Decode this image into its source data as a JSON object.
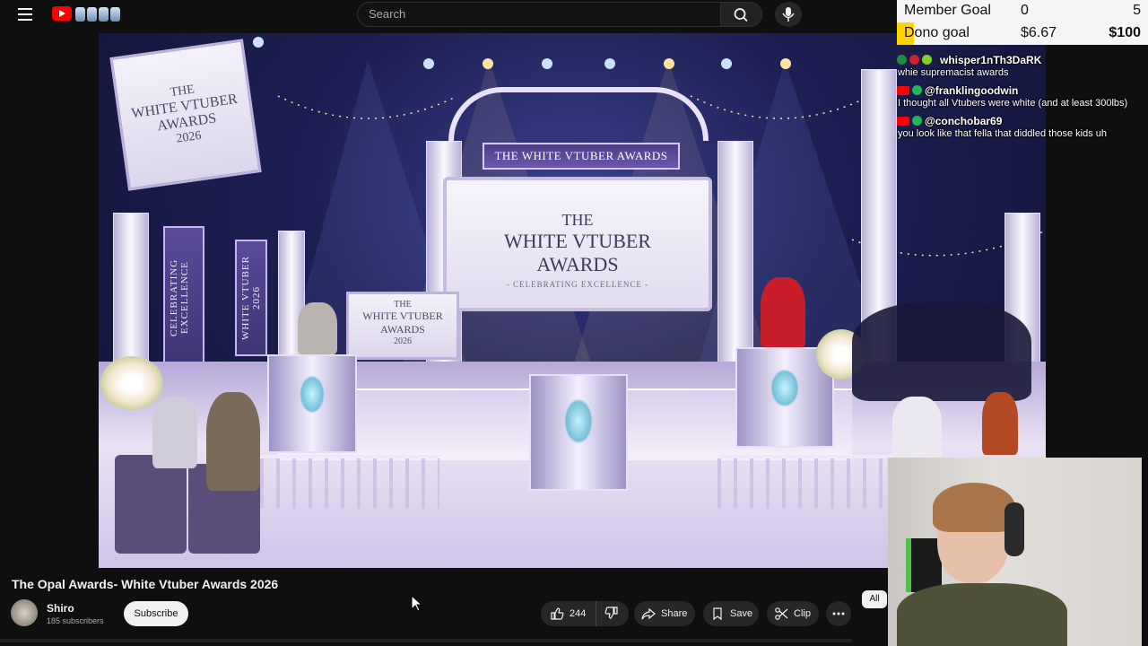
{
  "topbar": {
    "search_placeholder": "Search"
  },
  "overlay": {
    "member_goal": {
      "label": "Member Goal",
      "current": "0",
      "target": "5"
    },
    "dono_goal": {
      "label": "Dono goal",
      "current": "$6.67",
      "target": "$100",
      "progress": 0.067
    },
    "colors": {
      "goal_bg": "#f5f5f5",
      "goal_fill": "#ffd400"
    }
  },
  "chat": [
    {
      "user": "whisper1nTh3DaRK",
      "text": "whie supremacist awards"
    },
    {
      "user": "@franklingoodwin",
      "text": "I thought all Vtubers were white (and at least 300lbs)"
    },
    {
      "user": "@conchobar69",
      "text": "you look like that fella that diddled those kids uh"
    }
  ],
  "video_art": {
    "arch_ribbon": "THE WHITE VTUBER AWARDS",
    "main_sign": {
      "line1": "THE",
      "line2": "WHITE VTUBER",
      "line3": "AWARDS",
      "tagline": "- CELEBRATING EXCELLENCE -"
    },
    "left_sign": {
      "line1": "THE",
      "line2": "WHITE VTUBER",
      "line3": "AWARDS",
      "line4": "2026"
    },
    "podium_sign": {
      "line1": "THE",
      "line2": "WHITE VTUBER",
      "line3": "AWARDS",
      "line4": "2026"
    },
    "banner_left": "CELEBRATING EXCELLENCE",
    "banner_right": "WHITE VTUBER 2026"
  },
  "video_info": {
    "title": "The Opal Awards- White Vtuber Awards 2026",
    "channel": "Shiro",
    "subscribers": "185 subscribers",
    "subscribe_label": "Subscribe",
    "likes": "244",
    "share_label": "Share",
    "save_label": "Save",
    "clip_label": "Clip",
    "chip_all": "All"
  },
  "icons": {
    "menu": "menu-icon",
    "search": "search-icon",
    "mic": "mic-icon",
    "like": "thumbs-up-icon",
    "dislike": "thumbs-down-icon",
    "share": "share-arrow-icon",
    "save": "bookmark-icon",
    "clip": "scissors-icon",
    "more": "more-dots-icon"
  }
}
